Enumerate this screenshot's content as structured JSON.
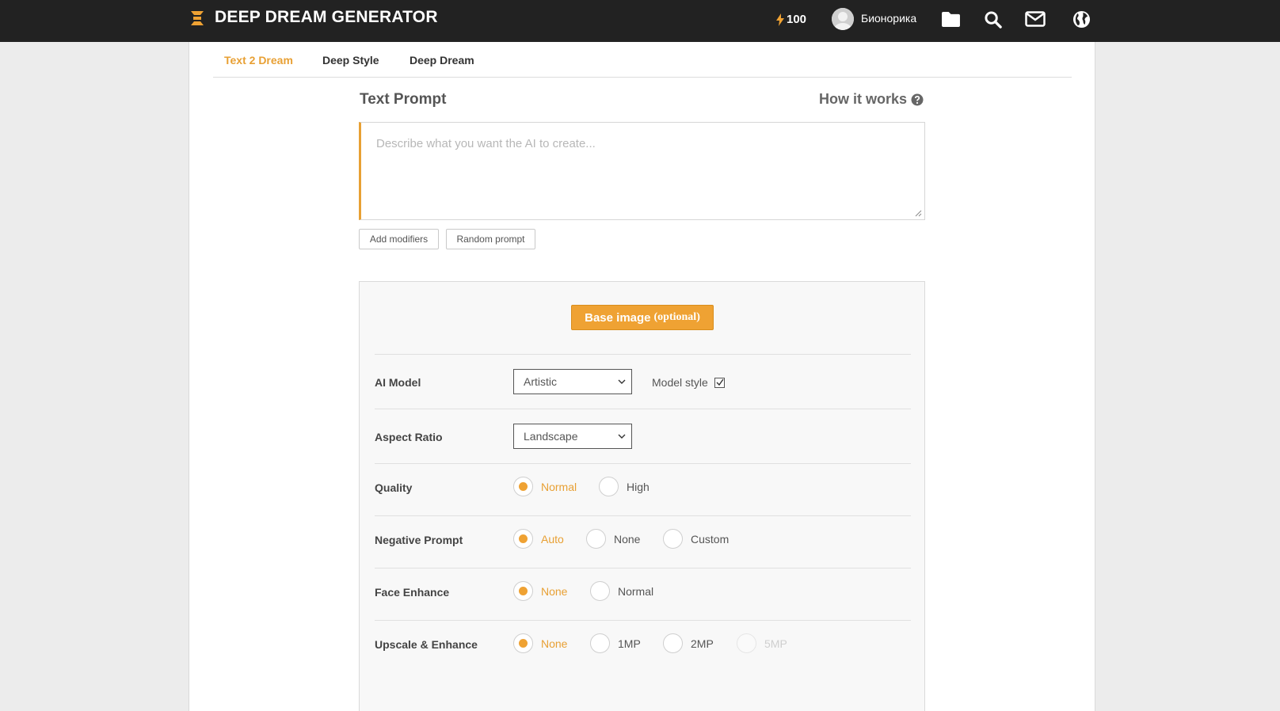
{
  "header": {
    "brand": "DEEP DREAM GENERATOR",
    "energy": "100",
    "username": "Бионорика",
    "icons": [
      "folder-icon",
      "search-icon",
      "mail-icon",
      "globe-icon"
    ]
  },
  "tabs": [
    {
      "label": "Text 2 Dream",
      "active": true
    },
    {
      "label": "Deep Style",
      "active": false
    },
    {
      "label": "Deep Dream",
      "active": false
    }
  ],
  "prompt": {
    "title": "Text Prompt",
    "how_it_works": "How it works",
    "placeholder": "Describe what you want the AI to create...",
    "value": "",
    "add_modifiers": "Add modifiers",
    "random_prompt": "Random prompt"
  },
  "settings": {
    "base_image": {
      "label": "Base image",
      "optional": "(optional)"
    },
    "ai_model": {
      "label": "AI Model",
      "value": "Artistic",
      "model_style_label": "Model style",
      "model_style_checked": true
    },
    "aspect_ratio": {
      "label": "Aspect Ratio",
      "value": "Landscape"
    },
    "quality": {
      "label": "Quality",
      "options": [
        "Normal",
        "High"
      ],
      "selected": "Normal"
    },
    "negative_prompt": {
      "label": "Negative Prompt",
      "options": [
        "Auto",
        "None",
        "Custom"
      ],
      "selected": "Auto"
    },
    "face_enhance": {
      "label": "Face Enhance",
      "options": [
        "None",
        "Normal"
      ],
      "selected": "None"
    },
    "upscale": {
      "label": "Upscale & Enhance",
      "options": [
        "None",
        "1MP",
        "2MP",
        "5MP"
      ],
      "selected": "None",
      "disabled": [
        "5MP"
      ]
    }
  },
  "colors": {
    "accent": "#efa233",
    "topbar": "#222222",
    "background": "#ececec"
  }
}
